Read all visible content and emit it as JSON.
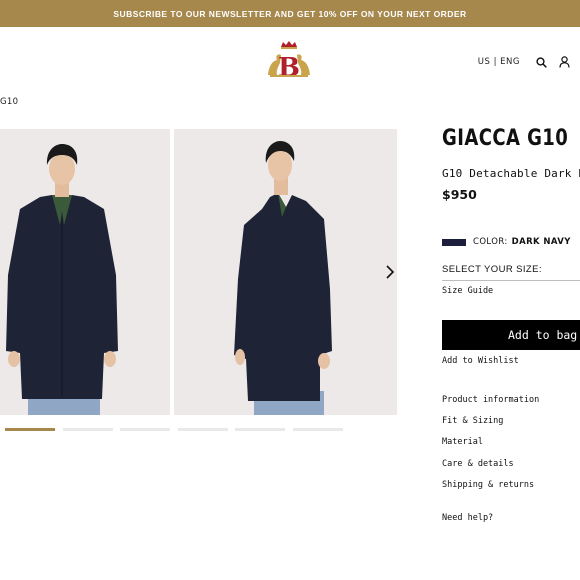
{
  "promo": {
    "text": "SUBSCRIBE TO OUR NEWSLETTER AND GET 10% OFF ON YOUR NEXT ORDER"
  },
  "header": {
    "logo_letter": "B",
    "locale": "US | ENG",
    "icons": [
      "search-icon",
      "account-icon"
    ]
  },
  "breadcrumb": {
    "current": "G10"
  },
  "gallery": {
    "image_count": 6,
    "active_index": 0,
    "next_icon": "chevron-right-icon"
  },
  "product": {
    "title": "GIACCA G10",
    "subtitle": "G10 Detachable Dark Navy",
    "price": "$950",
    "color_label": "COLOR:",
    "color_value": "DARK NAVY",
    "color_hex": "#1b1f3b",
    "size_label": "SELECT YOUR SIZE:",
    "size_guide": "Size Guide",
    "add_to_bag": "Add to bag",
    "wishlist": "Add to Wishlist"
  },
  "info_links": [
    "Product information",
    "Fit & Sizing",
    "Material",
    "Care & details",
    "Shipping & returns"
  ],
  "help": "Need help?",
  "colors": {
    "accent": "#a6884d",
    "button": "#000000",
    "photo_bg": "#ede9e9"
  }
}
